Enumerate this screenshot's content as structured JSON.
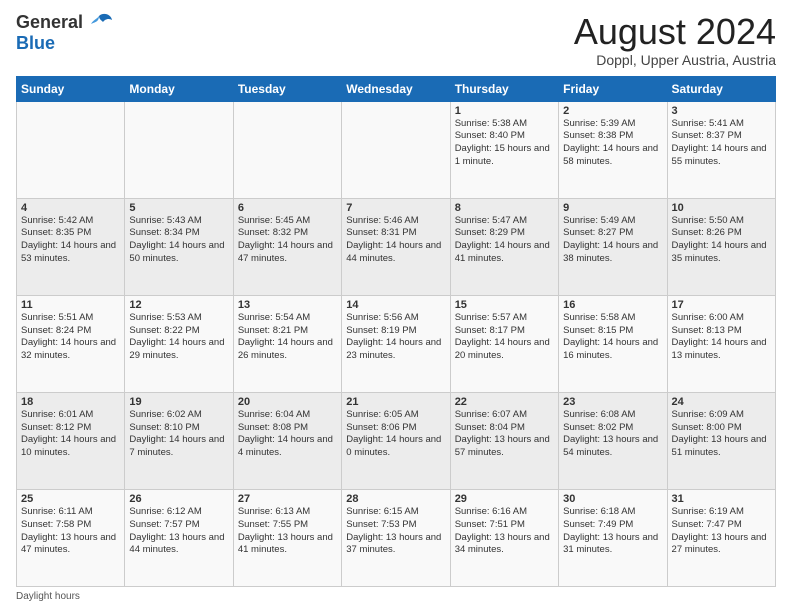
{
  "logo": {
    "line1": "General",
    "line2": "Blue"
  },
  "title": "August 2024",
  "location": "Doppl, Upper Austria, Austria",
  "days_of_week": [
    "Sunday",
    "Monday",
    "Tuesday",
    "Wednesday",
    "Thursday",
    "Friday",
    "Saturday"
  ],
  "footer": "Daylight hours",
  "weeks": [
    [
      {
        "day": "",
        "info": ""
      },
      {
        "day": "",
        "info": ""
      },
      {
        "day": "",
        "info": ""
      },
      {
        "day": "",
        "info": ""
      },
      {
        "day": "1",
        "info": "Sunrise: 5:38 AM\nSunset: 8:40 PM\nDaylight: 15 hours and 1 minute."
      },
      {
        "day": "2",
        "info": "Sunrise: 5:39 AM\nSunset: 8:38 PM\nDaylight: 14 hours and 58 minutes."
      },
      {
        "day": "3",
        "info": "Sunrise: 5:41 AM\nSunset: 8:37 PM\nDaylight: 14 hours and 55 minutes."
      }
    ],
    [
      {
        "day": "4",
        "info": "Sunrise: 5:42 AM\nSunset: 8:35 PM\nDaylight: 14 hours and 53 minutes."
      },
      {
        "day": "5",
        "info": "Sunrise: 5:43 AM\nSunset: 8:34 PM\nDaylight: 14 hours and 50 minutes."
      },
      {
        "day": "6",
        "info": "Sunrise: 5:45 AM\nSunset: 8:32 PM\nDaylight: 14 hours and 47 minutes."
      },
      {
        "day": "7",
        "info": "Sunrise: 5:46 AM\nSunset: 8:31 PM\nDaylight: 14 hours and 44 minutes."
      },
      {
        "day": "8",
        "info": "Sunrise: 5:47 AM\nSunset: 8:29 PM\nDaylight: 14 hours and 41 minutes."
      },
      {
        "day": "9",
        "info": "Sunrise: 5:49 AM\nSunset: 8:27 PM\nDaylight: 14 hours and 38 minutes."
      },
      {
        "day": "10",
        "info": "Sunrise: 5:50 AM\nSunset: 8:26 PM\nDaylight: 14 hours and 35 minutes."
      }
    ],
    [
      {
        "day": "11",
        "info": "Sunrise: 5:51 AM\nSunset: 8:24 PM\nDaylight: 14 hours and 32 minutes."
      },
      {
        "day": "12",
        "info": "Sunrise: 5:53 AM\nSunset: 8:22 PM\nDaylight: 14 hours and 29 minutes."
      },
      {
        "day": "13",
        "info": "Sunrise: 5:54 AM\nSunset: 8:21 PM\nDaylight: 14 hours and 26 minutes."
      },
      {
        "day": "14",
        "info": "Sunrise: 5:56 AM\nSunset: 8:19 PM\nDaylight: 14 hours and 23 minutes."
      },
      {
        "day": "15",
        "info": "Sunrise: 5:57 AM\nSunset: 8:17 PM\nDaylight: 14 hours and 20 minutes."
      },
      {
        "day": "16",
        "info": "Sunrise: 5:58 AM\nSunset: 8:15 PM\nDaylight: 14 hours and 16 minutes."
      },
      {
        "day": "17",
        "info": "Sunrise: 6:00 AM\nSunset: 8:13 PM\nDaylight: 14 hours and 13 minutes."
      }
    ],
    [
      {
        "day": "18",
        "info": "Sunrise: 6:01 AM\nSunset: 8:12 PM\nDaylight: 14 hours and 10 minutes."
      },
      {
        "day": "19",
        "info": "Sunrise: 6:02 AM\nSunset: 8:10 PM\nDaylight: 14 hours and 7 minutes."
      },
      {
        "day": "20",
        "info": "Sunrise: 6:04 AM\nSunset: 8:08 PM\nDaylight: 14 hours and 4 minutes."
      },
      {
        "day": "21",
        "info": "Sunrise: 6:05 AM\nSunset: 8:06 PM\nDaylight: 14 hours and 0 minutes."
      },
      {
        "day": "22",
        "info": "Sunrise: 6:07 AM\nSunset: 8:04 PM\nDaylight: 13 hours and 57 minutes."
      },
      {
        "day": "23",
        "info": "Sunrise: 6:08 AM\nSunset: 8:02 PM\nDaylight: 13 hours and 54 minutes."
      },
      {
        "day": "24",
        "info": "Sunrise: 6:09 AM\nSunset: 8:00 PM\nDaylight: 13 hours and 51 minutes."
      }
    ],
    [
      {
        "day": "25",
        "info": "Sunrise: 6:11 AM\nSunset: 7:58 PM\nDaylight: 13 hours and 47 minutes."
      },
      {
        "day": "26",
        "info": "Sunrise: 6:12 AM\nSunset: 7:57 PM\nDaylight: 13 hours and 44 minutes."
      },
      {
        "day": "27",
        "info": "Sunrise: 6:13 AM\nSunset: 7:55 PM\nDaylight: 13 hours and 41 minutes."
      },
      {
        "day": "28",
        "info": "Sunrise: 6:15 AM\nSunset: 7:53 PM\nDaylight: 13 hours and 37 minutes."
      },
      {
        "day": "29",
        "info": "Sunrise: 6:16 AM\nSunset: 7:51 PM\nDaylight: 13 hours and 34 minutes."
      },
      {
        "day": "30",
        "info": "Sunrise: 6:18 AM\nSunset: 7:49 PM\nDaylight: 13 hours and 31 minutes."
      },
      {
        "day": "31",
        "info": "Sunrise: 6:19 AM\nSunset: 7:47 PM\nDaylight: 13 hours and 27 minutes."
      }
    ]
  ]
}
